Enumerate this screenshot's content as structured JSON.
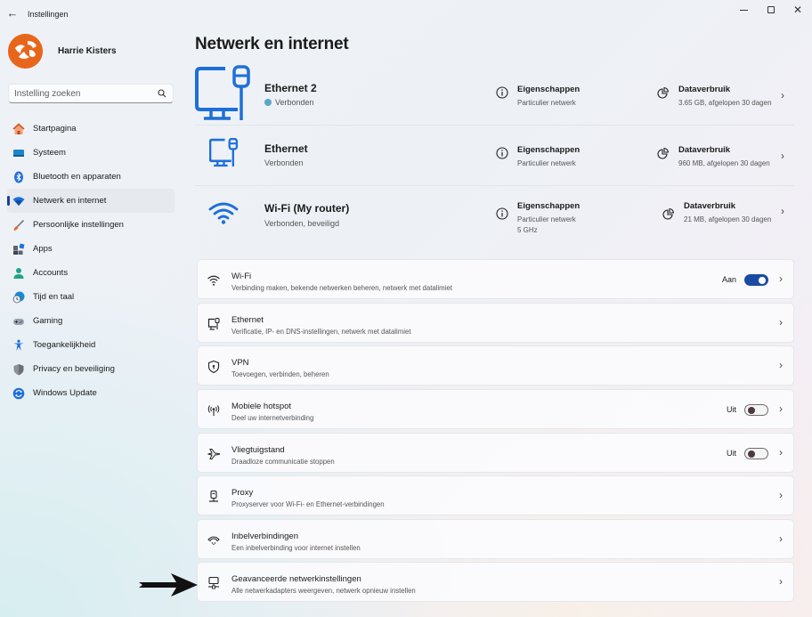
{
  "window": {
    "title": "Instellingen",
    "back_icon": "arrow-left-icon",
    "controls": [
      "minimize",
      "maximize",
      "close"
    ]
  },
  "profile": {
    "name": "Harrie Kisters"
  },
  "search": {
    "placeholder": "Instelling zoeken",
    "value": ""
  },
  "sidebar": {
    "items": [
      {
        "label": "Startpagina",
        "icon": "home-icon",
        "active": false
      },
      {
        "label": "Systeem",
        "icon": "monitor-icon",
        "active": false
      },
      {
        "label": "Bluetooth en apparaten",
        "icon": "bluetooth-icon",
        "active": false
      },
      {
        "label": "Netwerk en internet",
        "icon": "wifi-icon",
        "active": true
      },
      {
        "label": "Persoonlijke instellingen",
        "icon": "brush-icon",
        "active": false
      },
      {
        "label": "Apps",
        "icon": "apps-icon",
        "active": false
      },
      {
        "label": "Accounts",
        "icon": "person-icon",
        "active": false
      },
      {
        "label": "Tijd en taal",
        "icon": "globe-clock-icon",
        "active": false
      },
      {
        "label": "Gaming",
        "icon": "gamepad-icon",
        "active": false
      },
      {
        "label": "Toegankelijkheid",
        "icon": "accessibility-icon",
        "active": false
      },
      {
        "label": "Privacy en beveiliging",
        "icon": "shield-icon",
        "active": false
      },
      {
        "label": "Windows Update",
        "icon": "update-icon",
        "active": false
      }
    ]
  },
  "main": {
    "title": "Netwerk en internet",
    "connections": [
      {
        "name": "Ethernet 2",
        "status": "Verbonden",
        "icon": "ethernet-monitor-icon",
        "properties_title": "Eigenschappen",
        "properties_sub": [
          "Particulier netwerk"
        ],
        "usage_title": "Dataverbruik",
        "usage_sub": "3.65 GB, afgelopen 30 dagen"
      },
      {
        "name": "Ethernet",
        "status": "Verbonden",
        "icon": "ethernet-monitor-icon",
        "properties_title": "Eigenschappen",
        "properties_sub": [
          "Particulier netwerk"
        ],
        "usage_title": "Dataverbruik",
        "usage_sub": "960 MB, afgelopen 30 dagen"
      },
      {
        "name": "Wi-Fi (My router)",
        "status": "Verbonden, beveiligd",
        "icon": "wifi-icon",
        "properties_title": "Eigenschappen",
        "properties_sub": [
          "Particulier netwerk",
          "5 GHz"
        ],
        "usage_title": "Dataverbruik",
        "usage_sub": "21 MB, afgelopen 30 dagen"
      }
    ],
    "settings": [
      {
        "title": "Wi-Fi",
        "subtitle": "Verbinding maken, bekende netwerken beheren, netwerk met datalimiet",
        "icon": "wifi-icon",
        "toggle": {
          "label": "Aan",
          "on": true
        }
      },
      {
        "title": "Ethernet",
        "subtitle": "Verificatie, IP- en DNS-instellingen, netwerk met datalimiet",
        "icon": "ethernet-icon"
      },
      {
        "title": "VPN",
        "subtitle": "Toevoegen, verbinden, beheren",
        "icon": "vpn-shield-icon"
      },
      {
        "title": "Mobiele hotspot",
        "subtitle": "Deel uw internetverbinding",
        "icon": "hotspot-icon",
        "toggle": {
          "label": "Uit",
          "on": false
        }
      },
      {
        "title": "Vliegtuigstand",
        "subtitle": "Draadloze communicatie stoppen",
        "icon": "airplane-icon",
        "toggle": {
          "label": "Uit",
          "on": false
        }
      },
      {
        "title": "Proxy",
        "subtitle": "Proxyserver voor Wi-Fi- en Ethernet-verbindingen",
        "icon": "proxy-icon"
      },
      {
        "title": "Inbelverbindingen",
        "subtitle": "Een inbelverbinding voor internet instellen",
        "icon": "dialup-icon"
      },
      {
        "title": "Geavanceerde netwerkinstellingen",
        "subtitle": "Alle netwerkadapters weergeven, netwerk opnieuw instellen",
        "icon": "network-adapter-icon"
      }
    ]
  },
  "annotation": {
    "arrow_target": "Geavanceerde netwerkinstellingen"
  },
  "colors": {
    "accent": "#1a4ba3",
    "icon_blue": "#1e6fd9",
    "avatar": "#e8661c"
  }
}
